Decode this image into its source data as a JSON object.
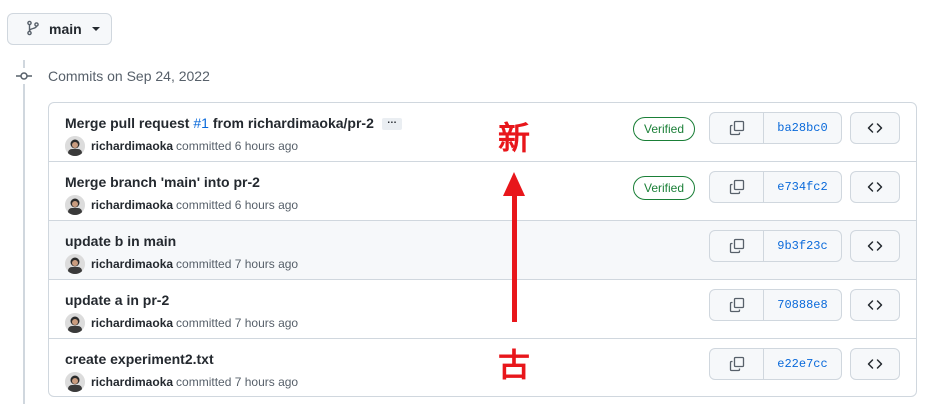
{
  "branch": {
    "name": "main"
  },
  "date_heading": "Commits on Sep 24, 2022",
  "commits": [
    {
      "message_prefix": "Merge pull request ",
      "pr_link": "#1",
      "message_suffix": " from richardimaoka/pr-2",
      "author": "richardimaoka",
      "time": "committed 6 hours ago",
      "verified": "Verified",
      "sha": "ba28bc0"
    },
    {
      "message": "Merge branch 'main' into pr-2",
      "author": "richardimaoka",
      "time": "committed 6 hours ago",
      "verified": "Verified",
      "sha": "e734fc2"
    },
    {
      "message": "update b in main",
      "author": "richardimaoka",
      "time": "committed 7 hours ago",
      "sha": "9b3f23c"
    },
    {
      "message": "update a in pr-2",
      "author": "richardimaoka",
      "time": "committed 7 hours ago",
      "sha": "70888e8"
    },
    {
      "message": "create experiment2.txt",
      "author": "richardimaoka",
      "time": "committed 7 hours ago",
      "sha": "e22e7cc"
    }
  ],
  "annotation": {
    "new_label": "新",
    "old_label": "古",
    "color": "#e8161b"
  },
  "colors": {
    "link": "#0969da",
    "verified": "#1a7f37",
    "border": "#d0d7de"
  },
  "icons": {
    "branch": "git-branch-icon",
    "commit": "git-commit-icon",
    "copy": "copy-icon",
    "browse": "code-icon"
  }
}
